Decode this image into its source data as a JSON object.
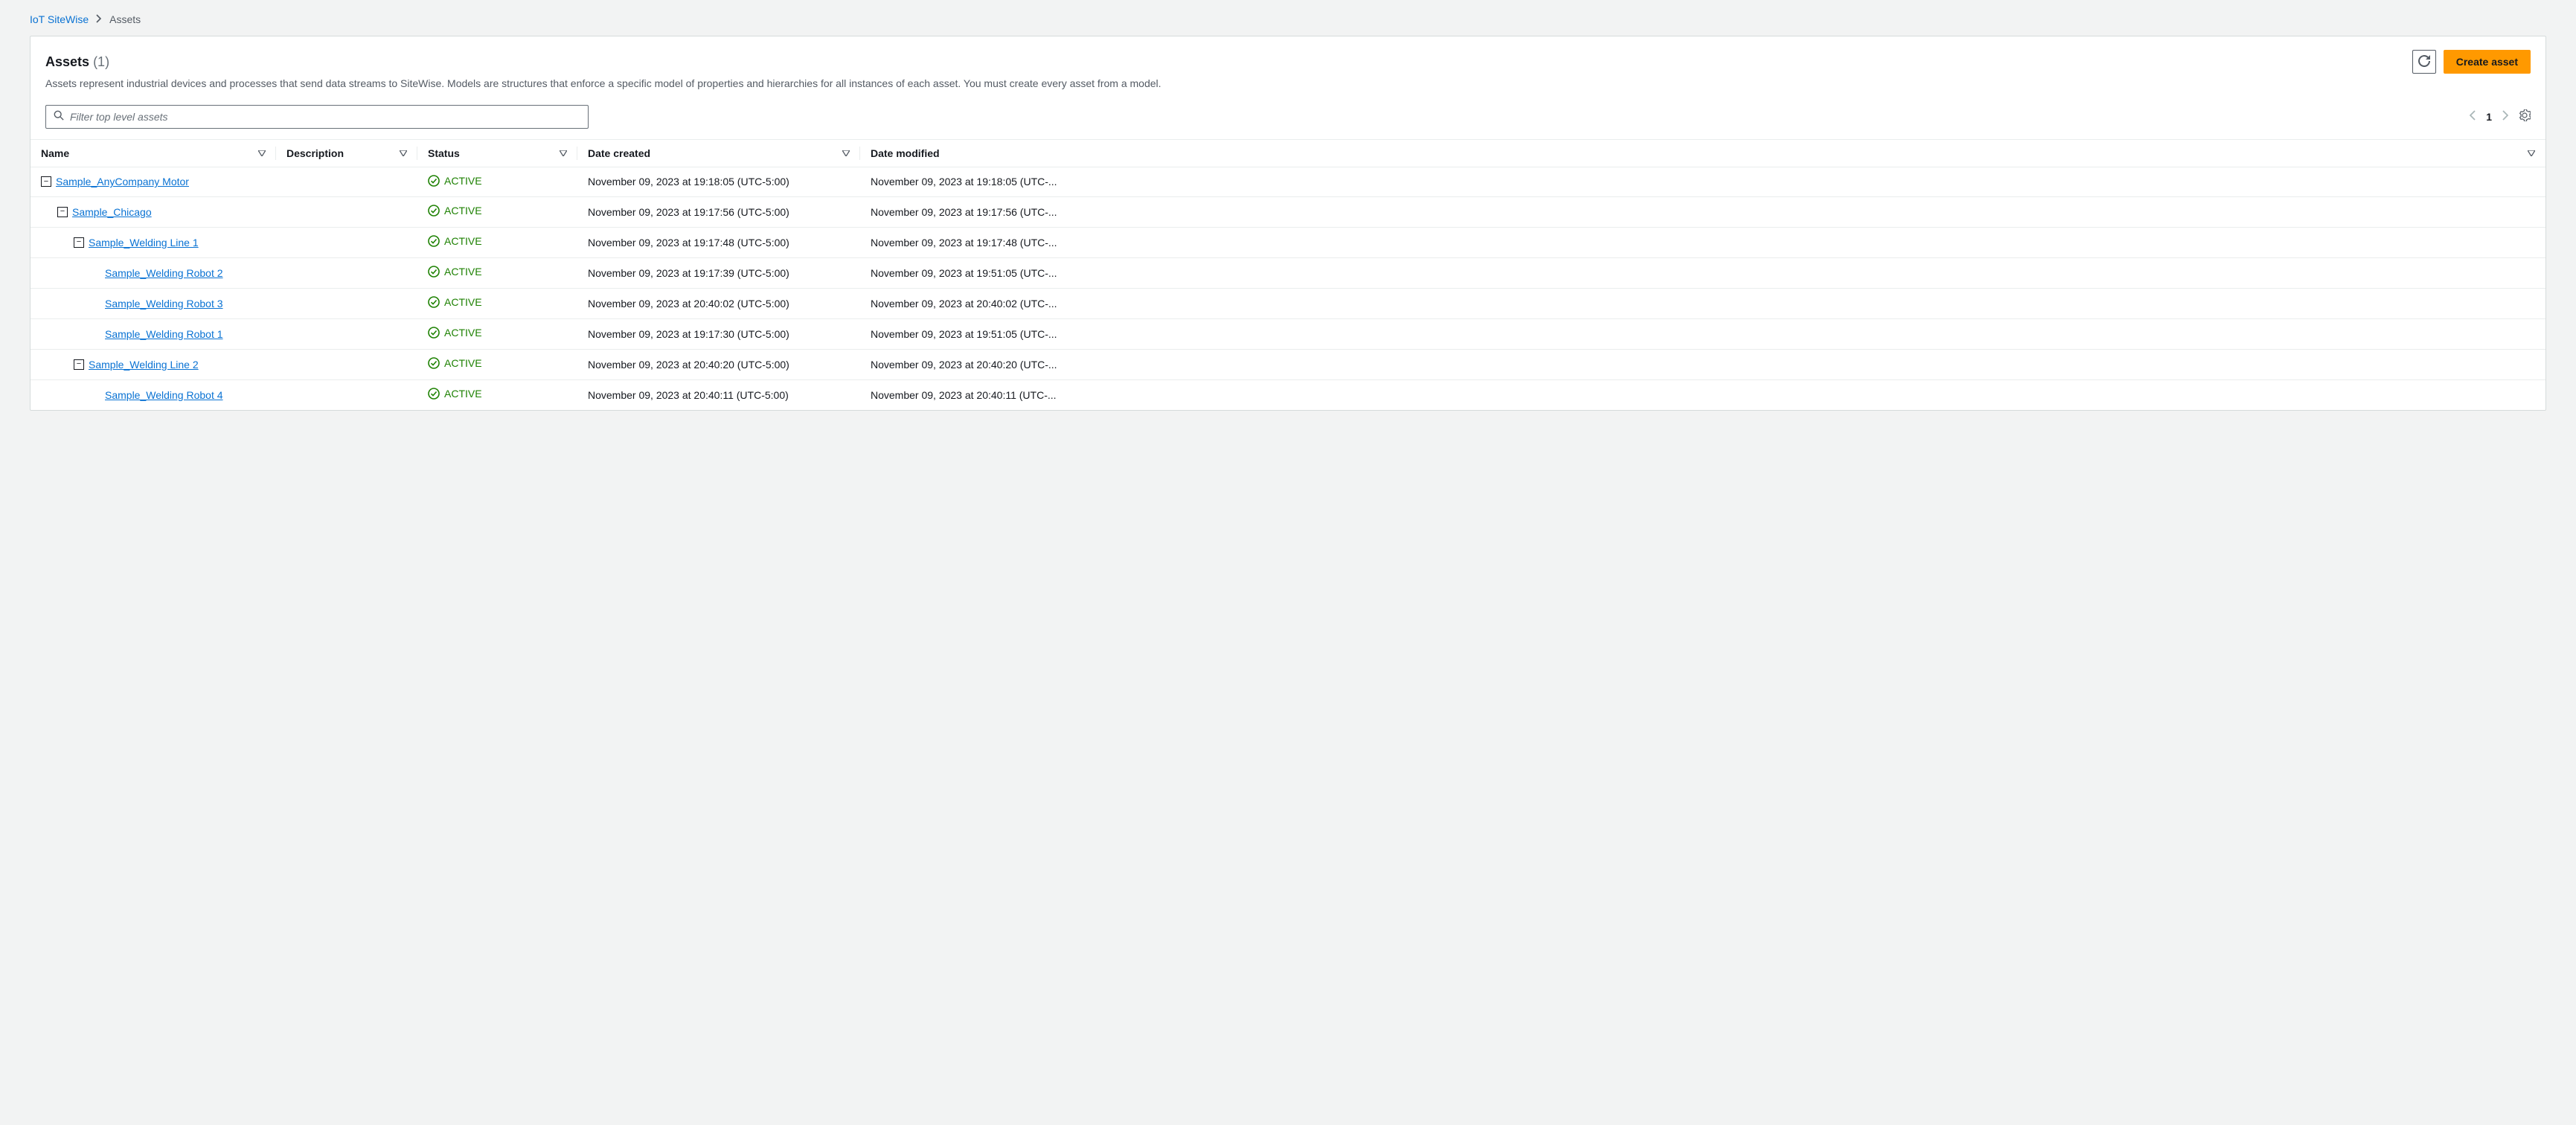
{
  "breadcrumb": {
    "root": "IoT SiteWise",
    "current": "Assets"
  },
  "header": {
    "title": "Assets",
    "count": "(1)",
    "description": "Assets represent industrial devices and processes that send data streams to SiteWise. Models are structures that enforce a specific model of properties and hierarchies for all instances of each asset. You must create every asset from a model.",
    "refresh_label": "Refresh",
    "create_label": "Create asset"
  },
  "filter": {
    "placeholder": "Filter top level assets"
  },
  "pagination": {
    "page": "1"
  },
  "columns": {
    "name": "Name",
    "description": "Description",
    "status": "Status",
    "created": "Date created",
    "modified": "Date modified"
  },
  "status_label": "ACTIVE",
  "rows": [
    {
      "indent": 0,
      "toggle": true,
      "name": "Sample_AnyCompany Motor",
      "desc": "",
      "created": "November 09, 2023 at 19:18:05 (UTC-5:00)",
      "modified": "November 09, 2023 at 19:18:05 (UTC-..."
    },
    {
      "indent": 1,
      "toggle": true,
      "name": "Sample_Chicago",
      "desc": "",
      "created": "November 09, 2023 at 19:17:56 (UTC-5:00)",
      "modified": "November 09, 2023 at 19:17:56 (UTC-..."
    },
    {
      "indent": 2,
      "toggle": true,
      "name": "Sample_Welding Line 1",
      "desc": "",
      "created": "November 09, 2023 at 19:17:48 (UTC-5:00)",
      "modified": "November 09, 2023 at 19:17:48 (UTC-..."
    },
    {
      "indent": 3,
      "toggle": false,
      "name": "Sample_Welding Robot 2",
      "desc": "",
      "created": "November 09, 2023 at 19:17:39 (UTC-5:00)",
      "modified": "November 09, 2023 at 19:51:05 (UTC-..."
    },
    {
      "indent": 3,
      "toggle": false,
      "name": "Sample_Welding Robot 3",
      "desc": "",
      "created": "November 09, 2023 at 20:40:02 (UTC-5:00)",
      "modified": "November 09, 2023 at 20:40:02 (UTC-..."
    },
    {
      "indent": 3,
      "toggle": false,
      "name": "Sample_Welding Robot 1",
      "desc": "",
      "created": "November 09, 2023 at 19:17:30 (UTC-5:00)",
      "modified": "November 09, 2023 at 19:51:05 (UTC-..."
    },
    {
      "indent": 2,
      "toggle": true,
      "name": "Sample_Welding Line 2",
      "desc": "",
      "created": "November 09, 2023 at 20:40:20 (UTC-5:00)",
      "modified": "November 09, 2023 at 20:40:20 (UTC-..."
    },
    {
      "indent": 3,
      "toggle": false,
      "name": "Sample_Welding Robot 4",
      "desc": "",
      "created": "November 09, 2023 at 20:40:11 (UTC-5:00)",
      "modified": "November 09, 2023 at 20:40:11 (UTC-..."
    }
  ]
}
